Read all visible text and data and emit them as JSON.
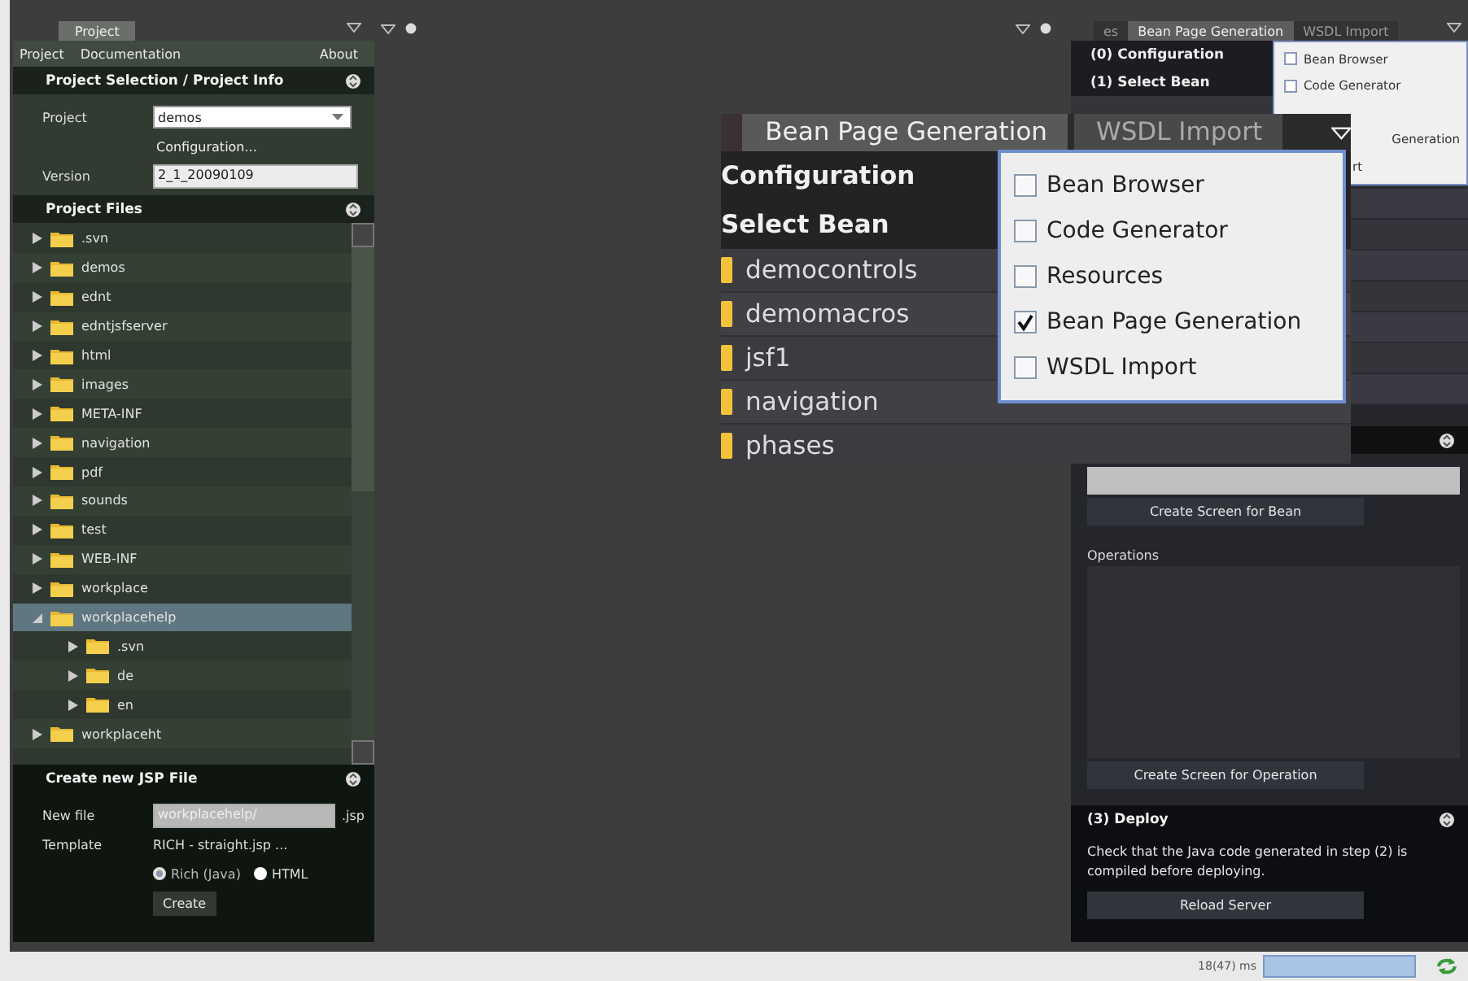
{
  "left_panel": {
    "tab": "Project",
    "menu": [
      "Project",
      "Documentation",
      "About"
    ],
    "selection": {
      "title": "Project Selection / Project Info",
      "project_label": "Project",
      "project_value": "demos",
      "configuration_link": "Configuration...",
      "version_label": "Version",
      "version_value": "2_1_20090109"
    },
    "files": {
      "title": "Project Files",
      "tree": [
        {
          "label": ".svn",
          "expanded": false,
          "selected": false
        },
        {
          "label": "demos",
          "expanded": false,
          "selected": false
        },
        {
          "label": "ednt",
          "expanded": false,
          "selected": false
        },
        {
          "label": "edntjsfserver",
          "expanded": false,
          "selected": false
        },
        {
          "label": "html",
          "expanded": false,
          "selected": false
        },
        {
          "label": "images",
          "expanded": false,
          "selected": false
        },
        {
          "label": "META-INF",
          "expanded": false,
          "selected": false
        },
        {
          "label": "navigation",
          "expanded": false,
          "selected": false
        },
        {
          "label": "pdf",
          "expanded": false,
          "selected": false
        },
        {
          "label": "sounds",
          "expanded": false,
          "selected": false
        },
        {
          "label": "test",
          "expanded": false,
          "selected": false
        },
        {
          "label": "WEB-INF",
          "expanded": false,
          "selected": false
        },
        {
          "label": "workplace",
          "expanded": false,
          "selected": false
        },
        {
          "label": "workplacehelp",
          "expanded": true,
          "selected": true,
          "children": [
            {
              "label": ".svn",
              "expanded": false,
              "selected": false
            },
            {
              "label": "de",
              "expanded": false,
              "selected": false
            },
            {
              "label": "en",
              "expanded": false,
              "selected": false
            }
          ]
        },
        {
          "label": "workplaceht",
          "expanded": false,
          "selected": false
        }
      ]
    },
    "create_jsp": {
      "title": "Create new JSP File",
      "new_file_label": "New file",
      "new_file_value": "workplacehelp/",
      "suffix": ".jsp",
      "template_label": "Template",
      "template_value": "RICH - straight.jsp ...",
      "radios": [
        {
          "label": "Rich (Java)",
          "selected": true
        },
        {
          "label": "HTML",
          "selected": false
        }
      ],
      "button": "Create"
    }
  },
  "right_panel": {
    "tabs": [
      {
        "label": "es",
        "selected": false
      },
      {
        "label": "Bean Page Generation",
        "selected": true
      },
      {
        "label": "WSDL Import",
        "selected": false
      }
    ],
    "steps": [
      "(0) Configuration",
      "(1) Select Bean"
    ],
    "tab_menu": [
      {
        "label": "Bean Browser",
        "checked": false
      },
      {
        "label": "Code Generator",
        "checked": false
      }
    ],
    "tab_menu_fragments": [
      "Generation",
      "rt"
    ],
    "create_bean_button": "Create Screen for Bean",
    "operations_label": "Operations",
    "create_operation_button": "Create Screen for Operation",
    "deploy": {
      "title": "(3) Deploy",
      "text": "Check that the Java code generated in step (2) is compiled before deploying.",
      "button": "Reload Server"
    }
  },
  "zoom_inset": {
    "tabs": [
      {
        "label": "Bean Page Generation",
        "selected": true
      },
      {
        "label": "WSDL Import",
        "selected": false
      }
    ],
    "steps": [
      "Configuration",
      "Select Bean"
    ],
    "beans": [
      "democontrols",
      "demomacros",
      "jsf1",
      "navigation",
      "phases"
    ],
    "tab_menu": [
      {
        "label": "Bean Browser",
        "checked": false
      },
      {
        "label": "Code Generator",
        "checked": false
      },
      {
        "label": "Resources",
        "checked": false
      },
      {
        "label": "Bean Page Generation",
        "checked": true
      },
      {
        "label": "WSDL Import",
        "checked": false
      }
    ]
  },
  "status_bar": {
    "timing": "18(47) ms"
  }
}
